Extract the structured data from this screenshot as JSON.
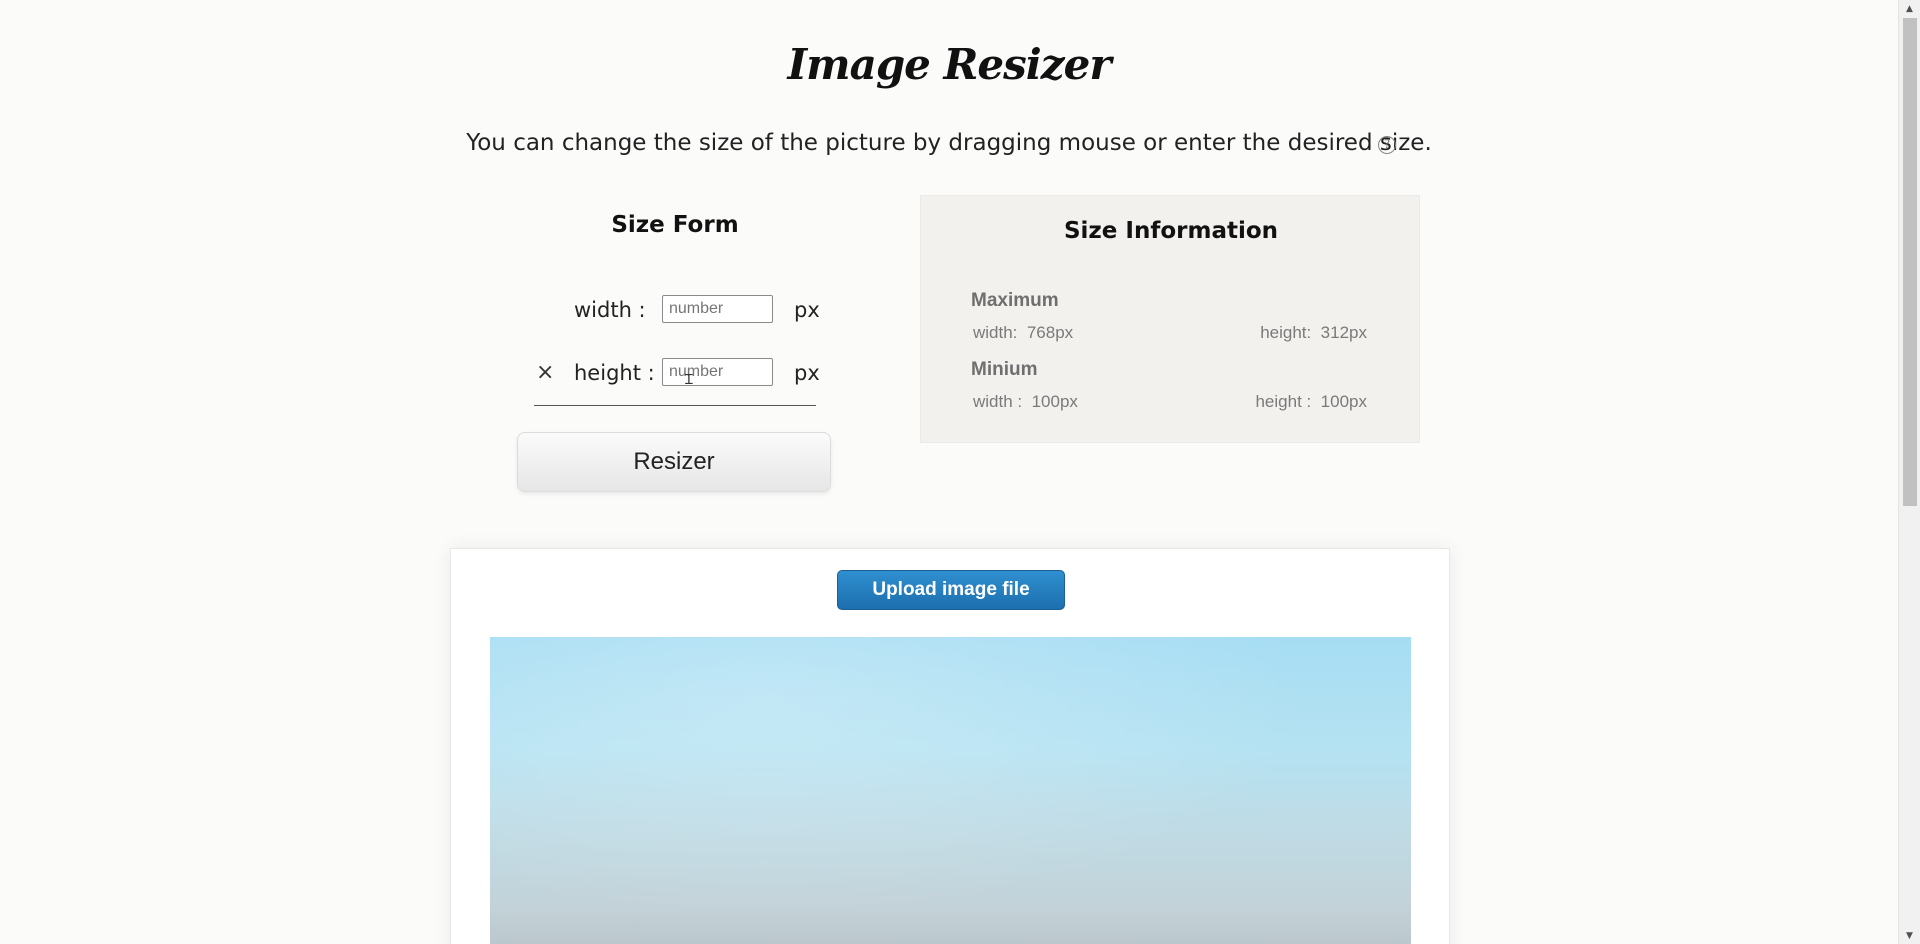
{
  "header": {
    "title": "Image Resizer",
    "subtitle": "You can change the size of the picture by dragging mouse or enter the desired size.",
    "help_icon": "?"
  },
  "size_form": {
    "title": "Size Form",
    "width_label": "width  :",
    "width_placeholder": "number",
    "width_unit": "px",
    "clear_symbol": "×",
    "height_label": "height :",
    "height_placeholder": "number",
    "height_unit": "px",
    "submit_label": "Resizer"
  },
  "size_info": {
    "title": "Size Information",
    "maximum": {
      "heading": "Maximum",
      "width": "width:  768px",
      "height": "height:  312px"
    },
    "minimum": {
      "heading": "Minium",
      "width": "width :  100px",
      "height": "height :  100px"
    }
  },
  "upload": {
    "button_label": "Upload image file"
  },
  "icons": {
    "help": "help-circle-icon",
    "clear": "close-icon",
    "cursor": "text-cursor-icon"
  },
  "colors": {
    "upload_button": "#1f73b4",
    "page_background": "#fbfbfa",
    "info_panel": "#f2f1ee"
  }
}
